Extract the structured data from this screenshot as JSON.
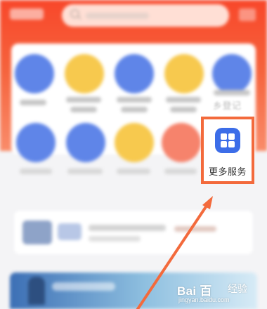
{
  "more_services": {
    "label": "更多服务",
    "icon": "grid-apps-icon",
    "icon_color": "#3c6de8"
  },
  "partial_service_label": "乡登记",
  "annotation": {
    "box_color": "#f36a3c",
    "arrow_color": "#f36a3c"
  },
  "watermark": {
    "logo": "Bai  百",
    "brand_cn": "经验",
    "url": "jingyan.baidu.com"
  },
  "colors": {
    "header": "#f8472a",
    "service_blue": "#5f85e8",
    "service_yellow": "#f7c94e",
    "service_salmon": "#f6836c"
  }
}
